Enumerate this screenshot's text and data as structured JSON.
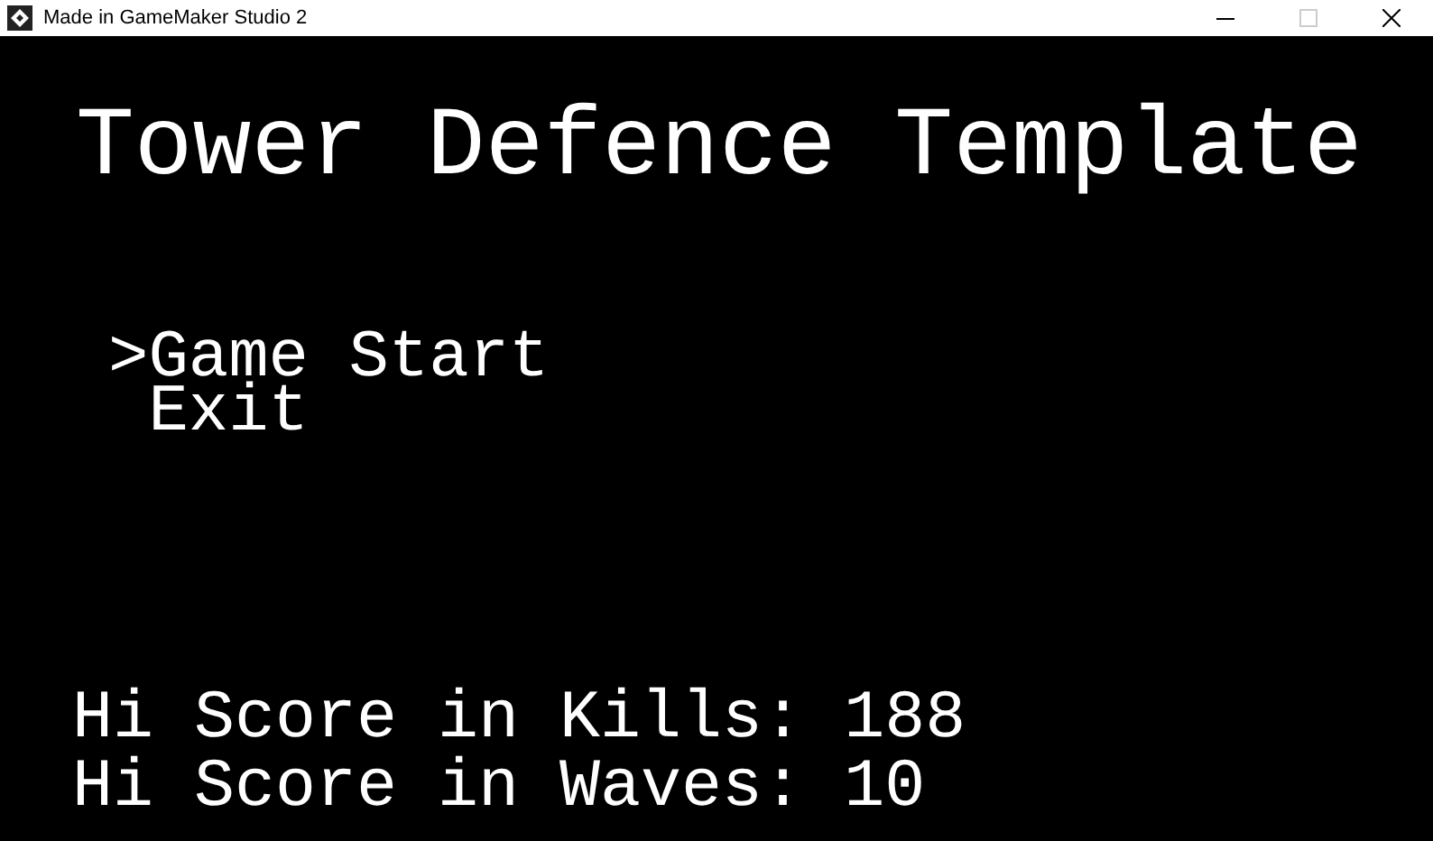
{
  "window": {
    "title": "Made in GameMaker Studio 2"
  },
  "title": "Tower Defence Template",
  "menu": {
    "cursor": ">",
    "items": [
      {
        "label": "Game Start",
        "selected": true
      },
      {
        "label": "Exit",
        "selected": false
      }
    ]
  },
  "scores": [
    "Hi Score in Kills: 188",
    "Hi Score in Waves: 10"
  ]
}
